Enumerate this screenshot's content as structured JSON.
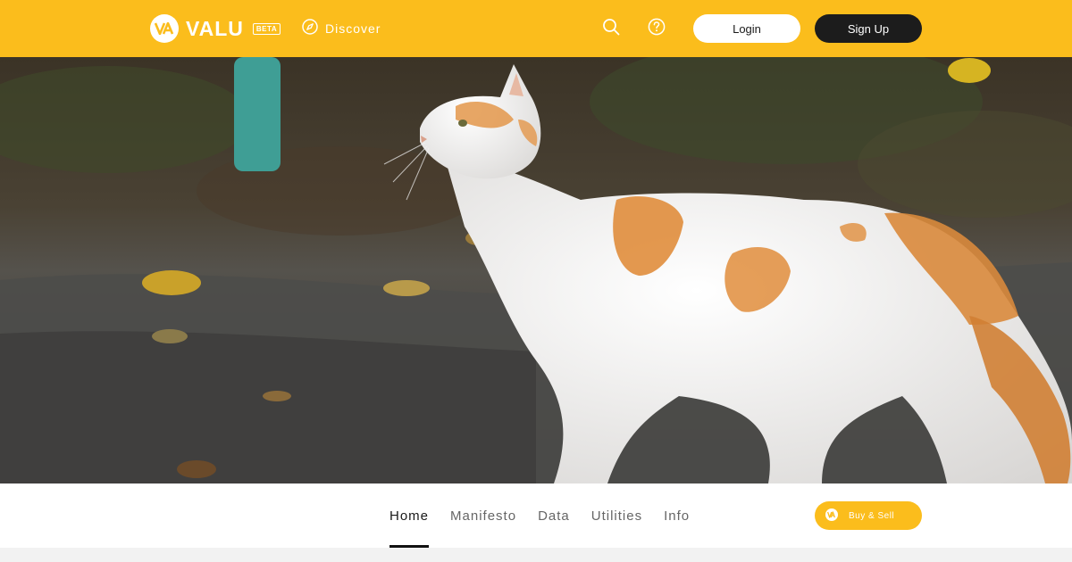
{
  "brand": {
    "name": "VALU",
    "badge": "BETA",
    "mark": "VA",
    "accent_color": "#fbbd1c",
    "dark_color": "#1c1c1c"
  },
  "nav": {
    "discover_label": "Discover",
    "discover_icon": "compass-icon",
    "search_icon": "search-icon",
    "help_icon": "help-icon"
  },
  "auth": {
    "login_label": "Login",
    "signup_label": "Sign Up"
  },
  "hero": {
    "image_subject": "white and orange cat walking on pavement"
  },
  "tabs": [
    {
      "label": "Home",
      "active": true
    },
    {
      "label": "Manifesto",
      "active": false
    },
    {
      "label": "Data",
      "active": false
    },
    {
      "label": "Utilities",
      "active": false
    },
    {
      "label": "Info",
      "active": false
    }
  ],
  "actions": {
    "buy_sell_label": "Buy & Sell",
    "buy_sell_icon": "valu-coin-icon"
  }
}
